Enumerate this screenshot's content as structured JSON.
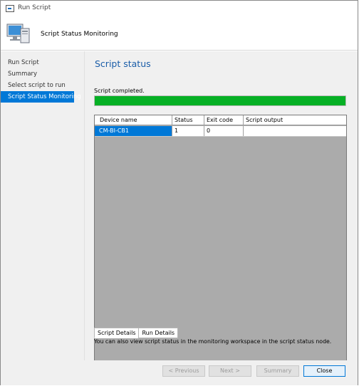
{
  "window": {
    "title": "Run Script",
    "header_title": "Script Status Monitoring"
  },
  "sidebar": {
    "items": [
      {
        "label": "Run Script",
        "active": false
      },
      {
        "label": "Summary",
        "active": false
      },
      {
        "label": "Select script to run",
        "active": false
      },
      {
        "label": "Script Status Monitoring",
        "active": true
      }
    ]
  },
  "main": {
    "section_title": "Script status",
    "completed_label": "Script completed.",
    "progress": {
      "percent": 100,
      "color": "#06b025"
    },
    "table": {
      "columns": [
        "Device name",
        "Status",
        "Exit code",
        "Script output"
      ],
      "rows": [
        [
          "CM-BI-CB1",
          "1",
          "0",
          ""
        ]
      ]
    },
    "tabs": [
      {
        "label": "Script Details",
        "active": true
      },
      {
        "label": "Run Details",
        "active": false
      }
    ],
    "note": "You can also view script status in the monitoring workspace in the script status node."
  },
  "footer": {
    "prev_label": "< Previous",
    "next_label": "Next >",
    "summary_label": "Summary",
    "close_label": "Close"
  },
  "colors": {
    "accent": "#0078d7",
    "section_title": "#1a5da8",
    "progress": "#06b025"
  },
  "icons": {
    "title": "window-icon",
    "header": "computer-monitor-icon"
  }
}
